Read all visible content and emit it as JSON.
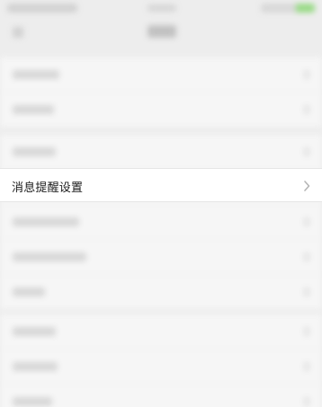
{
  "settings": {
    "focused_row_label": "消息提醒设置",
    "focused_row_chevron_icon": "chevron-right-icon"
  }
}
